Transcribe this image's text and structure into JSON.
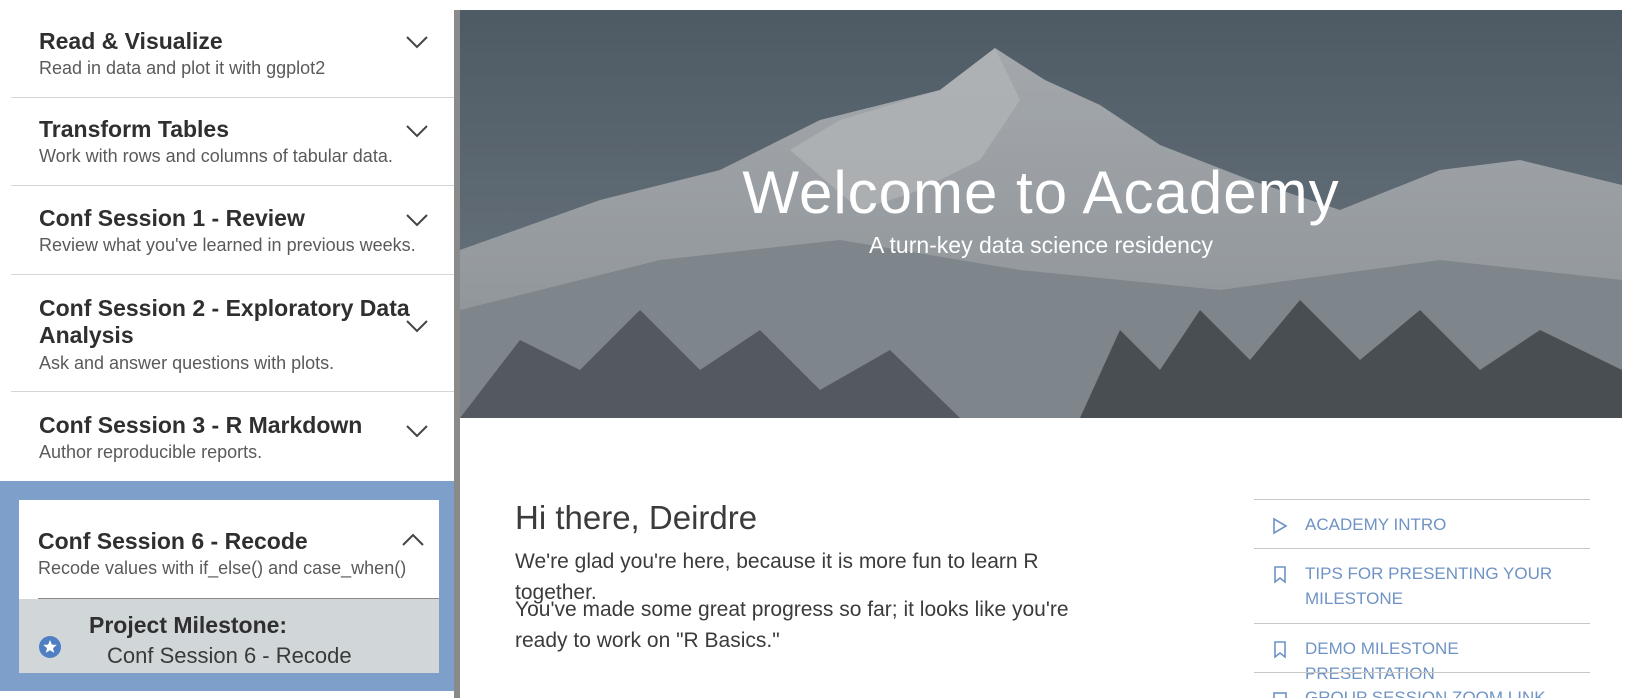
{
  "sidebar": {
    "modules": [
      {
        "title": "Read & Visualize",
        "subtitle": "Read in data and plot it with ggplot2"
      },
      {
        "title": "Transform Tables",
        "subtitle": "Work with rows and columns of tabular data."
      },
      {
        "title": "Conf Session 1 - Review",
        "subtitle": "Review what you've learned in previous weeks."
      },
      {
        "title": "Conf Session 2 - Exploratory Data",
        "title2": "Analysis",
        "subtitle": "Ask and answer questions with plots."
      },
      {
        "title": "Conf Session 3 - R Markdown",
        "subtitle": "Author reproducible reports."
      }
    ],
    "active_module": {
      "title": "Conf Session 6 - Recode",
      "subtitle": "Recode values with if_else() and case_when()",
      "milestone_title": "Project Milestone:",
      "milestone_sub": "Conf Session 6 - Recode"
    }
  },
  "hero": {
    "title": "Welcome to Academy",
    "subtitle": "A turn-key data science residency"
  },
  "main": {
    "greeting": "Hi there, Deirdre",
    "paragraph1": "We're glad you're here, because it is more fun to learn R together.",
    "paragraph2": "You've made some great progress so far; it looks like you're ready to work on \"R Basics.\""
  },
  "links": [
    {
      "label": "Academy Intro",
      "icon": "play-icon"
    },
    {
      "label": "Tips for presenting your milestone",
      "icon": "bookmark-icon"
    },
    {
      "label": "Demo milestone presentation",
      "icon": "bookmark-icon"
    },
    {
      "label": "Group session zoom link",
      "icon": "video-icon"
    }
  ],
  "colors": {
    "accent": "#6f93c4",
    "active_frame": "#7f9fcb",
    "milestone_bg": "#d1d6d9"
  }
}
